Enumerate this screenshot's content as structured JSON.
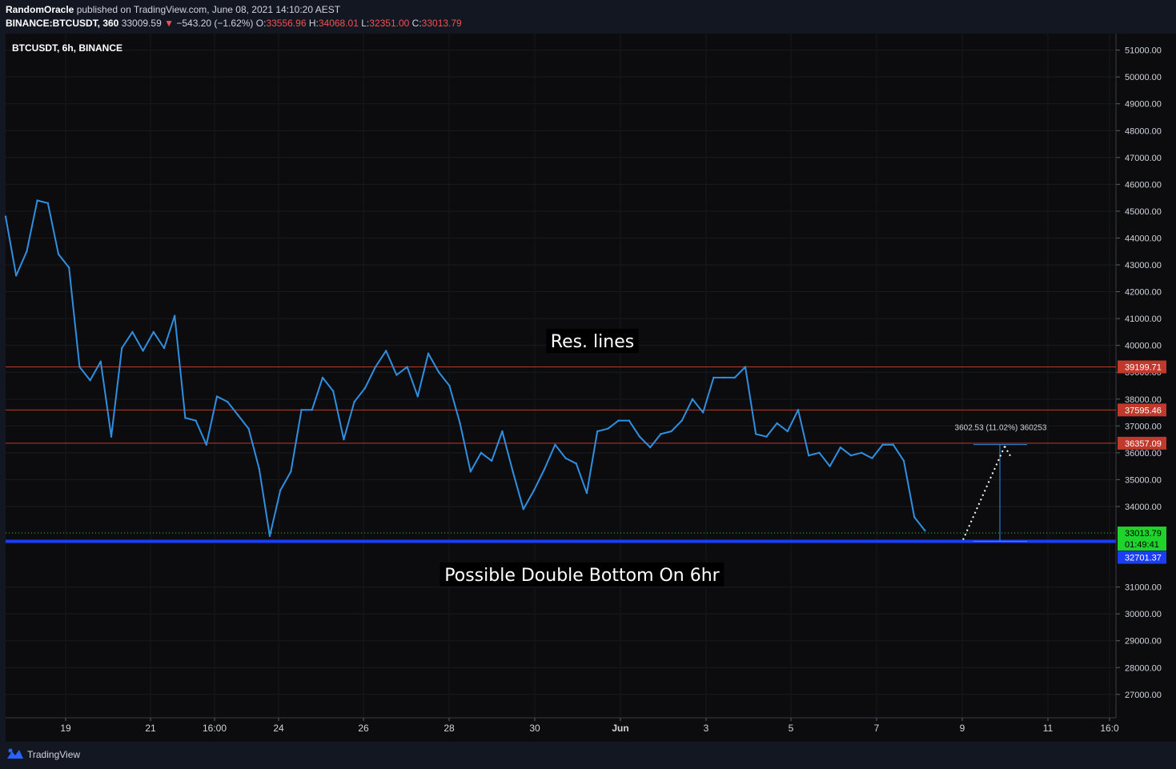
{
  "header": {
    "author": "RandomOracle",
    "published_text": "published on TradingView.com, June 08, 2021 14:10:20 AEST",
    "symbol": "BINANCE:BTCUSDT, 360",
    "price": "33009.59",
    "change": "−543.20 (−1.62%)",
    "open_label": "O:",
    "open": "33556.96",
    "high_label": "H:",
    "high": "34068.01",
    "low_label": "L:",
    "low": "32351.00",
    "close_label": "C:",
    "close": "33013.79"
  },
  "footer": {
    "brand": "TradingView"
  },
  "colors": {
    "background": "#0c0c0f",
    "price_line": "#2f8fe0",
    "resistance": "#c0392b",
    "support": "#1b3ff0",
    "current_price": "#1fd32a",
    "text": "#d1d4dc"
  },
  "chart_data": {
    "type": "line",
    "title": "BTCUSDT, 6h, BINANCE",
    "ylim": [
      26000,
      51500
    ],
    "y_ticks": [
      "51000.00",
      "50000.00",
      "49000.00",
      "48000.00",
      "47000.00",
      "46000.00",
      "45000.00",
      "44000.00",
      "43000.00",
      "42000.00",
      "41000.00",
      "40000.00",
      "39000.00",
      "38000.00",
      "37000.00",
      "36000.00",
      "35000.00",
      "34000.00",
      "31000.00",
      "30000.00",
      "29000.00",
      "28000.00",
      "27000.00"
    ],
    "x_ticks": [
      "19",
      "21",
      "16:00",
      "24",
      "26",
      "28",
      "30",
      "Jun",
      "3",
      "5",
      "7",
      "9",
      "11",
      "16:0"
    ],
    "series": [
      {
        "values": [
          44800,
          42600,
          43500,
          45400,
          45300,
          43400,
          42900,
          39200,
          38700,
          39400,
          36600,
          39900,
          40500,
          39800,
          40500,
          39900,
          41100,
          37300,
          37200,
          36300,
          38100,
          37900,
          37400,
          36900,
          35400,
          32900,
          34600,
          35300,
          37600,
          37600,
          38800,
          38300,
          36500,
          37900,
          38400,
          39200,
          39800,
          38900,
          39200,
          38100,
          39700,
          39000,
          38500,
          37100,
          35300,
          36000,
          35700,
          36800,
          35300,
          33900,
          34600,
          35400,
          36300,
          35800,
          35600,
          34500,
          36800,
          36900,
          37200,
          37200,
          36600,
          36200,
          36700,
          36800,
          37200,
          38000,
          37500,
          38800,
          38800,
          38800,
          39200,
          36700,
          36600,
          37100,
          36800,
          37600,
          35900,
          36000,
          35500,
          36200,
          35900,
          36000,
          35800,
          36300,
          36300,
          35700,
          33600,
          33100
        ]
      }
    ],
    "horizontal_lines": [
      {
        "value": 39199.71,
        "label": "39199.71",
        "color": "#c0392b"
      },
      {
        "value": 37595.46,
        "label": "37595.46",
        "color": "#c0392b"
      },
      {
        "value": 36357.09,
        "label": "36357.09",
        "color": "#c0392b"
      },
      {
        "value": 32701.37,
        "label": "32701.37",
        "color": "#1b3ff0"
      }
    ],
    "current_price": {
      "value": 33013.79,
      "label": "33013.79",
      "countdown": "01:49:41"
    },
    "measure": {
      "text": "3602.53 (11.02%) 360253",
      "from": 32701.37,
      "to": 36303.9
    },
    "annotations": [
      {
        "text": "Res. lines",
        "value": 40200
      },
      {
        "text": "Possible Double Bottom On 6hr",
        "value": 31500
      }
    ]
  }
}
